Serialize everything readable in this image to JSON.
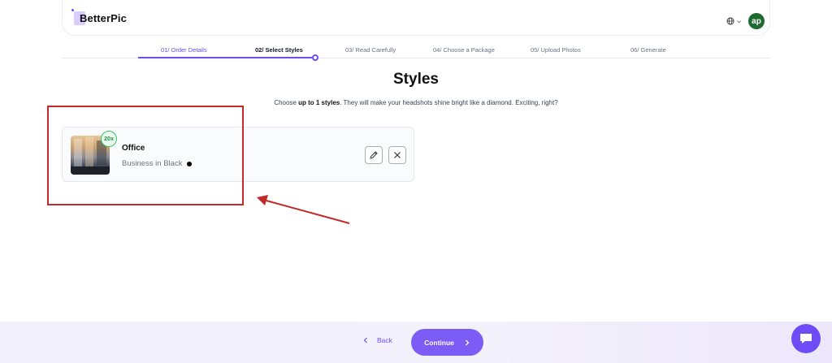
{
  "header": {
    "logo_text": "BetterPic",
    "language_icon": "globe-icon",
    "avatar_initials": "ap"
  },
  "steps": [
    {
      "label": "01/ Order Details",
      "state": "completed"
    },
    {
      "label": "02/ Select Styles",
      "state": "current"
    },
    {
      "label": "03/ Read Carefully",
      "state": "upcoming"
    },
    {
      "label": "04/ Choose a Package",
      "state": "upcoming"
    },
    {
      "label": "05/ Upload Photos",
      "state": "upcoming"
    },
    {
      "label": "06/ Generate",
      "state": "upcoming"
    }
  ],
  "main": {
    "title": "Styles",
    "subtitle_prefix": "Choose ",
    "subtitle_bold": "up to 1 styles",
    "subtitle_suffix": ". They will make your headshots shine bright like a diamond. Exciting, right?"
  },
  "style_card": {
    "badge": "20x",
    "name": "Office",
    "outfit": "Business in Black",
    "outfit_color": "#000000",
    "edit_icon": "pencil-icon",
    "remove_icon": "close-icon"
  },
  "footer": {
    "back_label": "Back",
    "continue_label": "Continue",
    "chat_icon": "chat-icon"
  },
  "colors": {
    "accent": "#6d4cf6",
    "annotation": "#c22b2b"
  }
}
